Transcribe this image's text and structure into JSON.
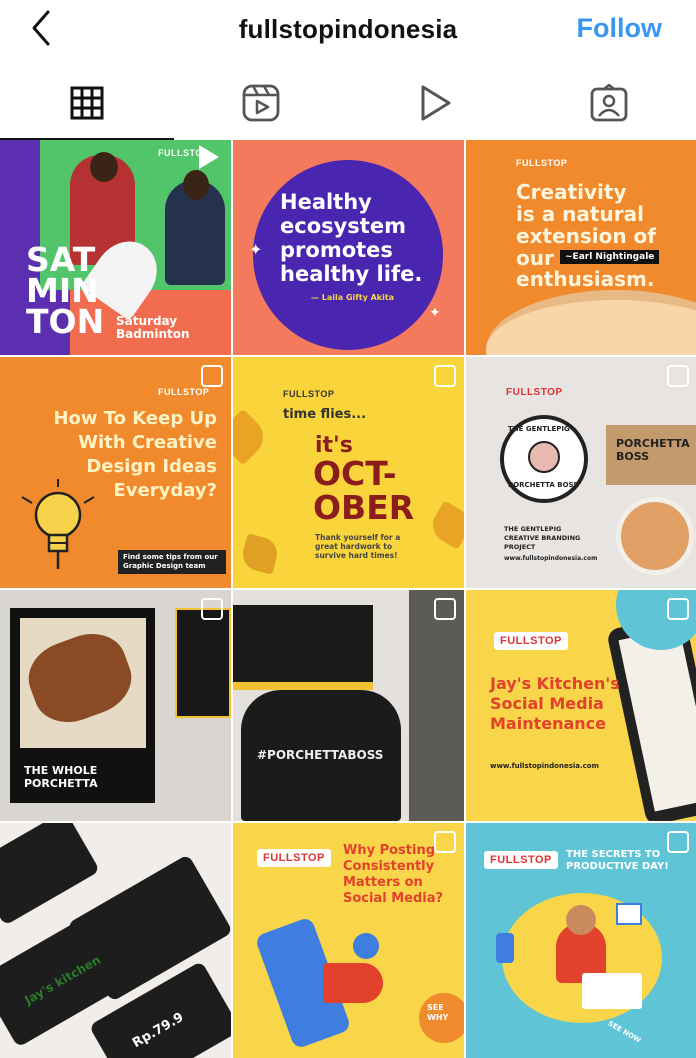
{
  "header": {
    "title": "fullstopindonesia",
    "follow_label": "Follow"
  },
  "tabs": [
    {
      "name": "grid-icon",
      "active": true
    },
    {
      "name": "reels-icon",
      "active": false
    },
    {
      "name": "video-icon",
      "active": false
    },
    {
      "name": "tagged-icon",
      "active": false
    }
  ],
  "posts": {
    "p1": {
      "big": "SAT\nMIN\nTON",
      "sub": "Saturday\nBadminton"
    },
    "p2": {
      "quote": "Healthy\necosystem\npromotes\nhealthy life.",
      "author": "— Laila Gifty Akita"
    },
    "p3": {
      "line1": "Creativity",
      "line2": "is a natural",
      "line3": "extension of",
      "line4": "our",
      "line5": "enthusiasm.",
      "author": "~Earl Nightingale"
    },
    "p4": {
      "heading": "How To Keep Up\nWith Creative\nDesign Ideas\nEveryday?",
      "cta": "Find some tips from our\nGraphic Design team"
    },
    "p5": {
      "small": "time flies...",
      "its": "it's",
      "month": "OCT-\nOBER",
      "caption": "Thank yourself for a\ngreat hardwork to\nsurvive hard times!"
    },
    "p6": {
      "badge_top": "THE GENTLEPIG",
      "badge_bottom": "PORCHETTA BOSS",
      "desc": "THE GENTLEPIG\nCREATIVE BRANDING\nPROJECT",
      "url": "www.fullstopindonesia.com",
      "box": "PORCHETTA\nBOSS"
    },
    "p7": {
      "caption": "THE WHOLE\nPORCHETTA"
    },
    "p8": {
      "shirt": "#PORCHETTABOSS"
    },
    "p9": {
      "heading": "Jay's Kitchen's\nSocial Media\nMaintenance",
      "url": "www.fullstopindonesia.com"
    },
    "p10": {
      "label1": "Jay's kitchen",
      "price": "Rp.79.9"
    },
    "p11": {
      "heading": "Why Posting\nConsistently\nMatters on\nSocial Media?",
      "see": "SEE\nWHY"
    },
    "p12": {
      "heading": "THE SECRETS TO\nPRODUCTIVE DAY!",
      "see": "SEE NOW"
    }
  },
  "brand": {
    "logo_text": "FULLSTOP"
  },
  "colors": {
    "accent": "#3897f0",
    "orange": "#f08a2c",
    "purple": "#4a2aa8",
    "yellow": "#f7c928",
    "teal": "#5fc4d6"
  }
}
